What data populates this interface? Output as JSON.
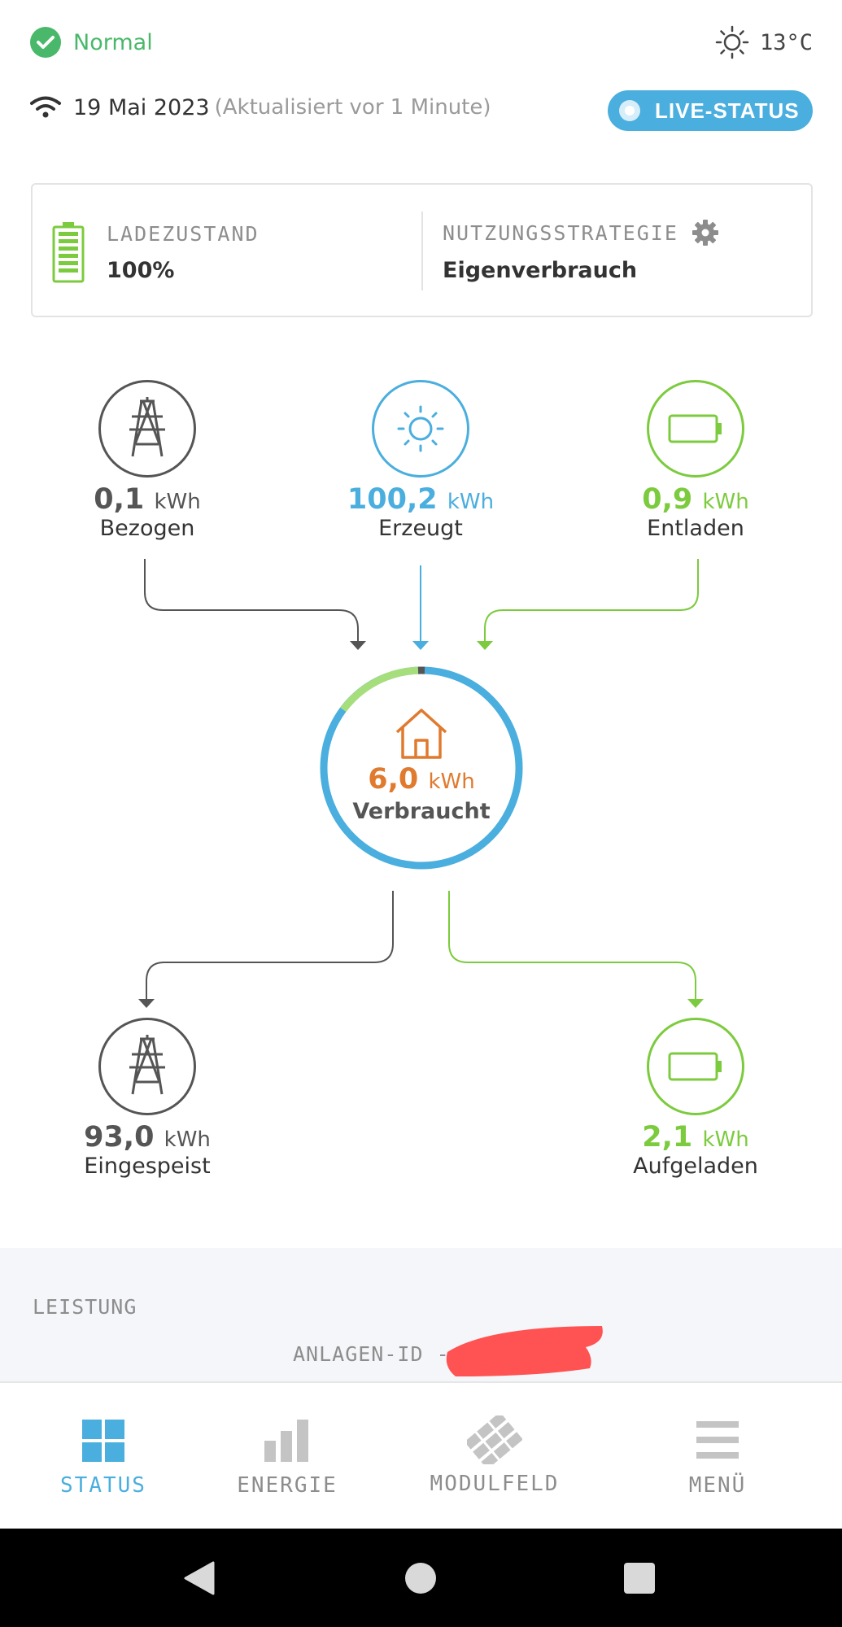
{
  "status": {
    "label": "Normal",
    "temperature": "13°C"
  },
  "info": {
    "date": "19 Mai 2023",
    "updated": "(Aktualisiert vor 1 Minute)",
    "live_label": "LIVE-STATUS"
  },
  "card": {
    "charge_label": "LADEZUSTAND",
    "charge_value": "100%",
    "strategy_label": "NUTZUNGSSTRATEGIE",
    "strategy_value": "Eigenverbrauch"
  },
  "flow": {
    "grid_in": {
      "value": "0,1",
      "unit": "kWh",
      "label": "Bezogen"
    },
    "solar": {
      "value": "100,2",
      "unit": "kWh",
      "label": "Erzeugt"
    },
    "battery_out": {
      "value": "0,9",
      "unit": "kWh",
      "label": "Entladen"
    },
    "house": {
      "value": "6,0",
      "unit": "kWh",
      "label": "Verbraucht"
    },
    "grid_out": {
      "value": "93,0",
      "unit": "kWh",
      "label": "Eingespeist"
    },
    "battery_in": {
      "value": "2,1",
      "unit": "kWh",
      "label": "Aufgeladen"
    }
  },
  "section": {
    "title": "LEISTUNG",
    "system_id_label": "ANLAGEN-ID -"
  },
  "nav": {
    "status": "STATUS",
    "energy": "ENERGIE",
    "module": "MODULFELD",
    "menu": "MENÜ"
  },
  "colors": {
    "blue": "#4aaede",
    "green": "#7ccb3e",
    "grey": "#555555",
    "orange": "#e07a2e",
    "redact": "#ff5252"
  }
}
